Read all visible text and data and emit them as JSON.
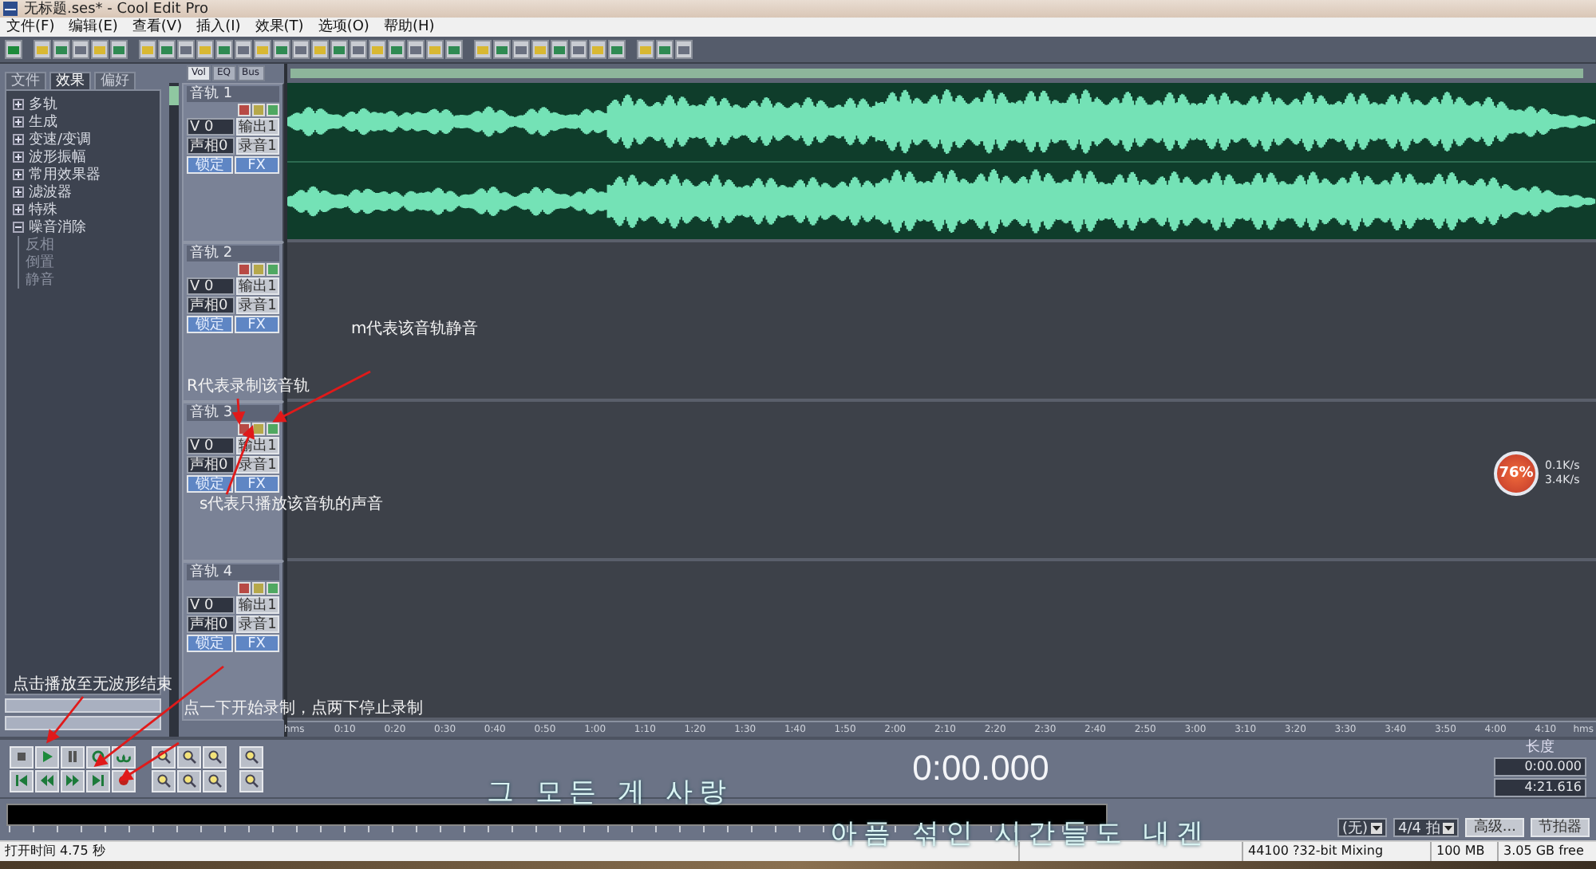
{
  "window": {
    "title": "无标题.ses* - Cool Edit Pro"
  },
  "menu": [
    "文件(F)",
    "编辑(E)",
    "查看(V)",
    "插入(I)",
    "效果(T)",
    "选项(O)",
    "帮助(H)"
  ],
  "left_panel": {
    "tabs": [
      {
        "label": "文件",
        "selected": false
      },
      {
        "label": "效果",
        "selected": true
      },
      {
        "label": "偏好",
        "selected": false
      }
    ],
    "tree": [
      {
        "label": "多轨",
        "expanded": false
      },
      {
        "label": "生成",
        "expanded": false
      },
      {
        "label": "变速/变调",
        "expanded": false
      },
      {
        "label": "波形振幅",
        "expanded": false
      },
      {
        "label": "常用效果器",
        "expanded": false
      },
      {
        "label": "滤波器",
        "expanded": false
      },
      {
        "label": "特殊",
        "expanded": false
      },
      {
        "label": "噪音消除",
        "expanded": true,
        "children": [
          {
            "label": "反相"
          },
          {
            "label": "倒置"
          },
          {
            "label": "静音"
          }
        ]
      }
    ]
  },
  "mixer_tabs": [
    {
      "label": "Vol",
      "selected": true
    },
    {
      "label": "EQ",
      "selected": false
    },
    {
      "label": "Bus",
      "selected": false
    }
  ],
  "tracks": [
    {
      "name": "音轨 1",
      "volume": "V 0",
      "output": "输出1",
      "pan": "声相0",
      "input": "录音1",
      "lock": "锁定",
      "fx": "FX",
      "has_audio": true
    },
    {
      "name": "音轨 2",
      "volume": "V 0",
      "output": "输出1",
      "pan": "声相0",
      "input": "录音1",
      "lock": "锁定",
      "fx": "FX",
      "has_audio": false
    },
    {
      "name": "音轨 3",
      "volume": "V 0",
      "output": "输出1",
      "pan": "声相0",
      "input": "录音1",
      "lock": "锁定",
      "fx": "FX",
      "has_audio": false
    },
    {
      "name": "音轨 4",
      "volume": "V 0",
      "output": "输出1",
      "pan": "声相0",
      "input": "录音1",
      "lock": "锁定",
      "fx": "FX",
      "has_audio": false
    }
  ],
  "ruler": [
    "hms",
    "0:10",
    "0:20",
    "0:30",
    "0:40",
    "0:50",
    "1:00",
    "1:10",
    "1:20",
    "1:30",
    "1:40",
    "1:50",
    "2:00",
    "2:10",
    "2:20",
    "2:30",
    "2:40",
    "2:50",
    "3:00",
    "3:10",
    "3:20",
    "3:30",
    "3:40",
    "3:50",
    "4:00",
    "4:10",
    "hms"
  ],
  "time_display": "0:00.000",
  "length_panel": {
    "label": "长度",
    "values": [
      "0:00.000",
      "4:21.616"
    ]
  },
  "tempo": {
    "key": "(无)",
    "meter": "4/4 拍",
    "buttons": [
      "高级...",
      "节拍器"
    ]
  },
  "status_bar": [
    "打开时间 4.75 秒",
    "44100 ?32-bit Mixing",
    "100 MB",
    "3.05 GB free"
  ],
  "net_widget": {
    "percent": "76%",
    "upload": "0.1K/s",
    "download": "3.4K/s"
  },
  "annotations": [
    "m代表该音轨静音",
    "R代表录制该音轨",
    "s代表只播放该音轨的声音",
    "点击播放至无波形结束",
    "点一下开始录制，点两下停止录制"
  ],
  "lyrics": [
    "그 모든 게 사랑",
    "아픔 섞인 시간들도 내겐"
  ]
}
